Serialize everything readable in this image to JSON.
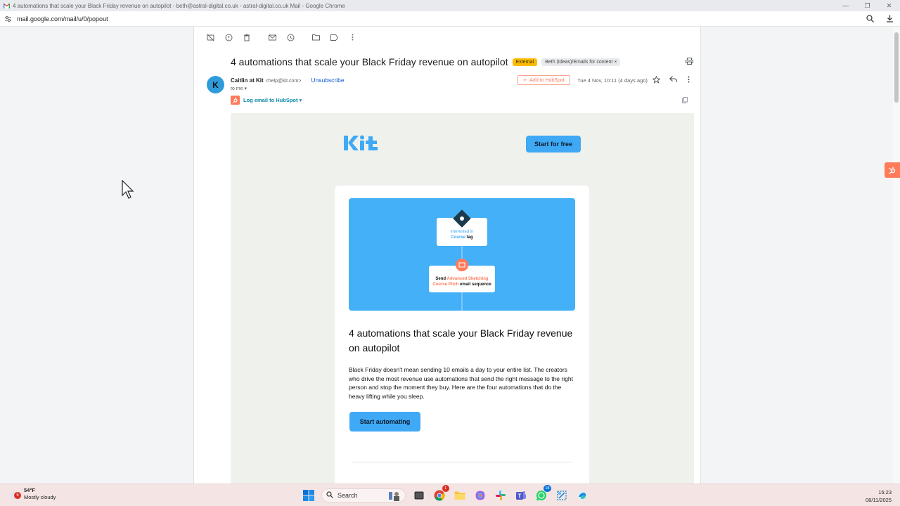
{
  "window": {
    "title": "4 automations that scale your Black Friday revenue on autopilot - beth@astral-digital.co.uk - astral-digital.co.uk Mail - Google Chrome",
    "minimize": "—",
    "restore": "❐",
    "close": "✕"
  },
  "address_bar": {
    "url": "mail.google.com/mail/u/0/popout"
  },
  "mail": {
    "subject": "4 automations that scale your Black Friday revenue on autopilot",
    "badge_external": "External",
    "label_tag": "Beth (Ideas)/Emails for content",
    "label_remove": "×",
    "sender_name": "Caitlin at Kit",
    "sender_email": "<help@kit.com>",
    "unsubscribe": "Unsubscribe",
    "to_me": "to me ▾",
    "avatar_letter": "K",
    "add_to_hubspot": "Add to HubSpot",
    "date": "Tue 4 Nov, 10:11 (4 days ago)",
    "log_email": "Log email to HubSpot ▾"
  },
  "email_content": {
    "logo": "Kit",
    "start_for_free": "Start for free",
    "hero": {
      "node1_line1": "Interested in",
      "node1_line2a": "Course",
      "node1_line2b": " tag",
      "node2_line1a": "Send ",
      "node2_line1b": "Advanced Sketching",
      "node2_line2a": "Course Pitch",
      "node2_line2b": " email sequence"
    },
    "title": "4 automations that scale your Black Friday revenue on autopilot",
    "body": "Black Friday doesn't mean sending 10 emails a day to your entire list. The creators who drive the most revenue use automations that send the right message to the right person and stop the moment they buy. Here are the four automations that do the heavy lifting while you sleep.",
    "start_automating": "Start automating"
  },
  "taskbar": {
    "weather_temp": "54°F",
    "weather_desc": "Mostly cloudy",
    "weather_badge": "5",
    "search_label": "Search",
    "chrome_badge": "1",
    "whatsapp_badge": "18",
    "time": "15:23",
    "date": "08/11/2025"
  },
  "colors": {
    "accent_blue": "#3fa9f5",
    "hubspot_orange": "#ff7a59",
    "external_badge": "#fbbc04"
  }
}
